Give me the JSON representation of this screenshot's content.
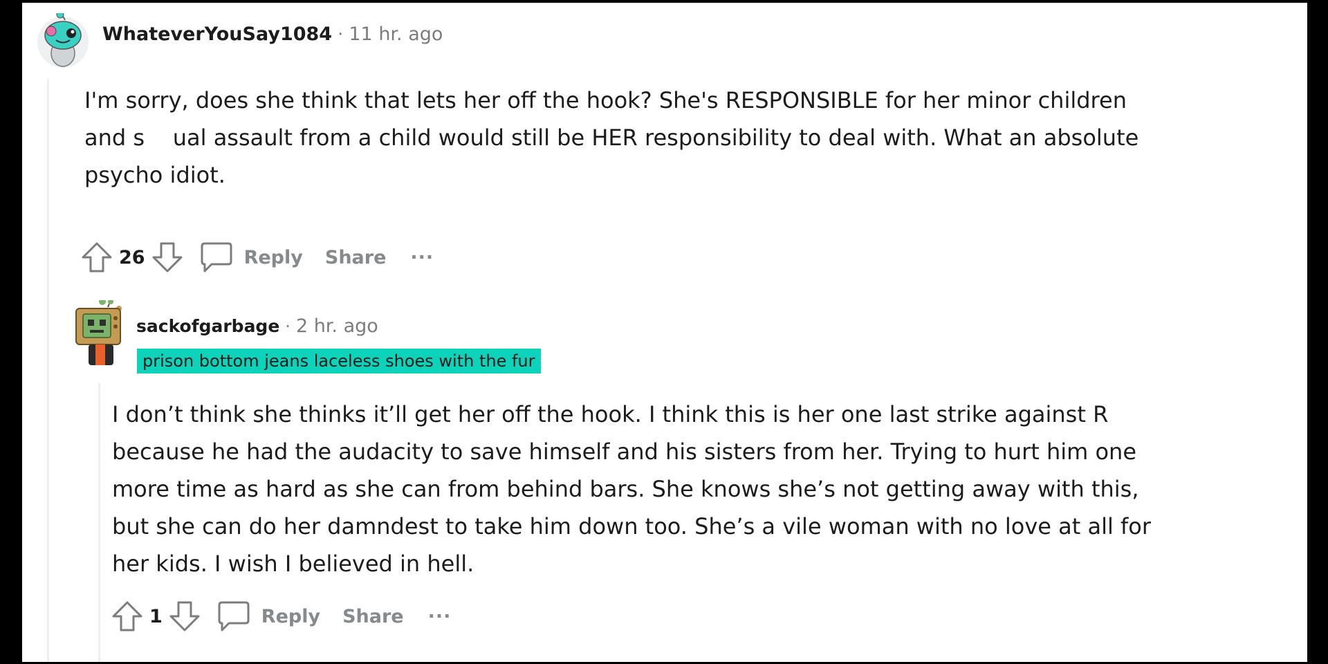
{
  "comments": [
    {
      "username": "WhateverYouSay1084",
      "separator": "·",
      "time": "11 hr. ago",
      "body_lines": [
        "I'm sorry, does she think that lets her off the hook? She's RESPONSIBLE for her minor children",
        "and s    ual assault from a child would still be HER responsibility to deal with. What an absolute",
        "psycho idiot."
      ],
      "votes": "26",
      "reply_label": "Reply",
      "share_label": "Share",
      "more_label": "···",
      "avatar_color": "#3ad1c4"
    },
    {
      "username": "sackofgarbage",
      "separator": "·",
      "time": "2 hr. ago",
      "flair": "prison bottom jeans laceless shoes with the fur",
      "body_lines": [
        "I don’t think she thinks it’ll get her off the hook. I think this is her one last strike against R",
        "because he had the audacity to save himself and his sisters from her. Trying to hurt him one",
        "more time as hard as she can from behind bars. She knows she’s not getting away with this,",
        "but she can do her damndest to take him down too. She’s a vile woman with no love at all for",
        "her kids. I wish I believed in hell."
      ],
      "votes": "1",
      "reply_label": "Reply",
      "share_label": "Share",
      "more_label": "···",
      "avatar_color": "#7bb36a"
    }
  ],
  "colors": {
    "flair_background": "#0dd3bb",
    "meta_text": "#7c7c7c",
    "action_text": "#878a8c",
    "thread_line": "#edeff1"
  }
}
